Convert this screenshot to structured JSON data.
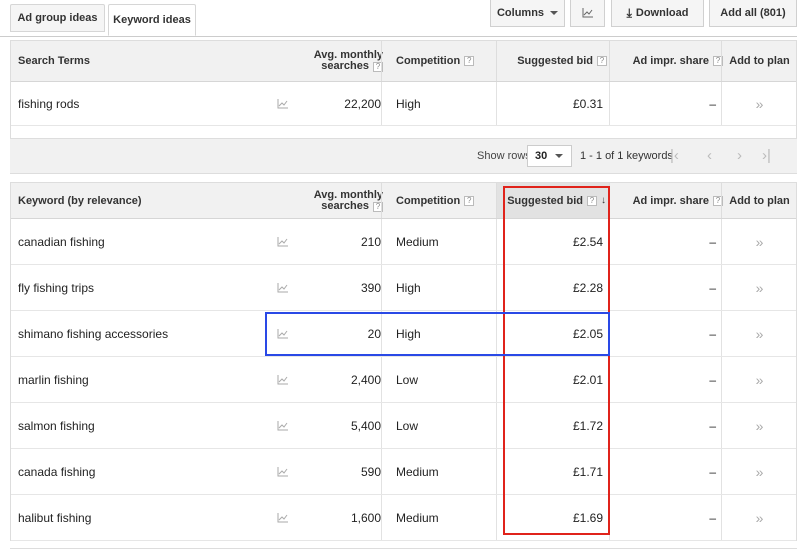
{
  "tabs": [
    {
      "label": "Ad group ideas"
    },
    {
      "label": "Keyword ideas"
    }
  ],
  "toolbar": {
    "columns_label": "Columns",
    "download_label": "Download",
    "add_all_label": "Add all (801)"
  },
  "search_table": {
    "headers": {
      "keyword": "Search Terms",
      "avg_line1": "Avg. monthly",
      "avg_line2": "searches",
      "competition": "Competition",
      "bid": "Suggested bid",
      "impr": "Ad impr. share",
      "plan": "Add to plan"
    },
    "rows": [
      {
        "keyword": "fishing rods",
        "searches": "22,200",
        "competition": "High",
        "bid": "£0.31",
        "impr": "–"
      }
    ]
  },
  "pager": {
    "show_rows_label": "Show rows",
    "rows_value": "30",
    "range_text": "1 - 1 of 1 keywords"
  },
  "ideas_table": {
    "headers": {
      "keyword": "Keyword (by relevance)",
      "avg_line1": "Avg. monthly",
      "avg_line2": "searches",
      "competition": "Competition",
      "bid": "Suggested bid",
      "impr": "Ad impr. share",
      "plan": "Add to plan"
    },
    "rows": [
      {
        "keyword": "canadian fishing",
        "searches": "210",
        "competition": "Medium",
        "bid": "£2.54",
        "impr": "–"
      },
      {
        "keyword": "fly fishing trips",
        "searches": "390",
        "competition": "High",
        "bid": "£2.28",
        "impr": "–"
      },
      {
        "keyword": "shimano fishing accessories",
        "searches": "20",
        "competition": "High",
        "bid": "£2.05",
        "impr": "–"
      },
      {
        "keyword": "marlin fishing",
        "searches": "2,400",
        "competition": "Low",
        "bid": "£2.01",
        "impr": "–"
      },
      {
        "keyword": "salmon fishing",
        "searches": "5,400",
        "competition": "Low",
        "bid": "£1.72",
        "impr": "–"
      },
      {
        "keyword": "canada fishing",
        "searches": "590",
        "competition": "Medium",
        "bid": "£1.71",
        "impr": "–"
      },
      {
        "keyword": "halibut fishing",
        "searches": "1,600",
        "competition": "Medium",
        "bid": "£1.69",
        "impr": "–"
      }
    ]
  },
  "glyphs": {
    "help": "?",
    "plan_arrow": "»",
    "sort_arrow": "↓",
    "download_arrow": "⤓",
    "first": "|‹",
    "prev": "‹",
    "next": "›",
    "last": "›|"
  },
  "colors": {
    "highlight_red": "#e0231b",
    "highlight_blue": "#2a49e6"
  }
}
